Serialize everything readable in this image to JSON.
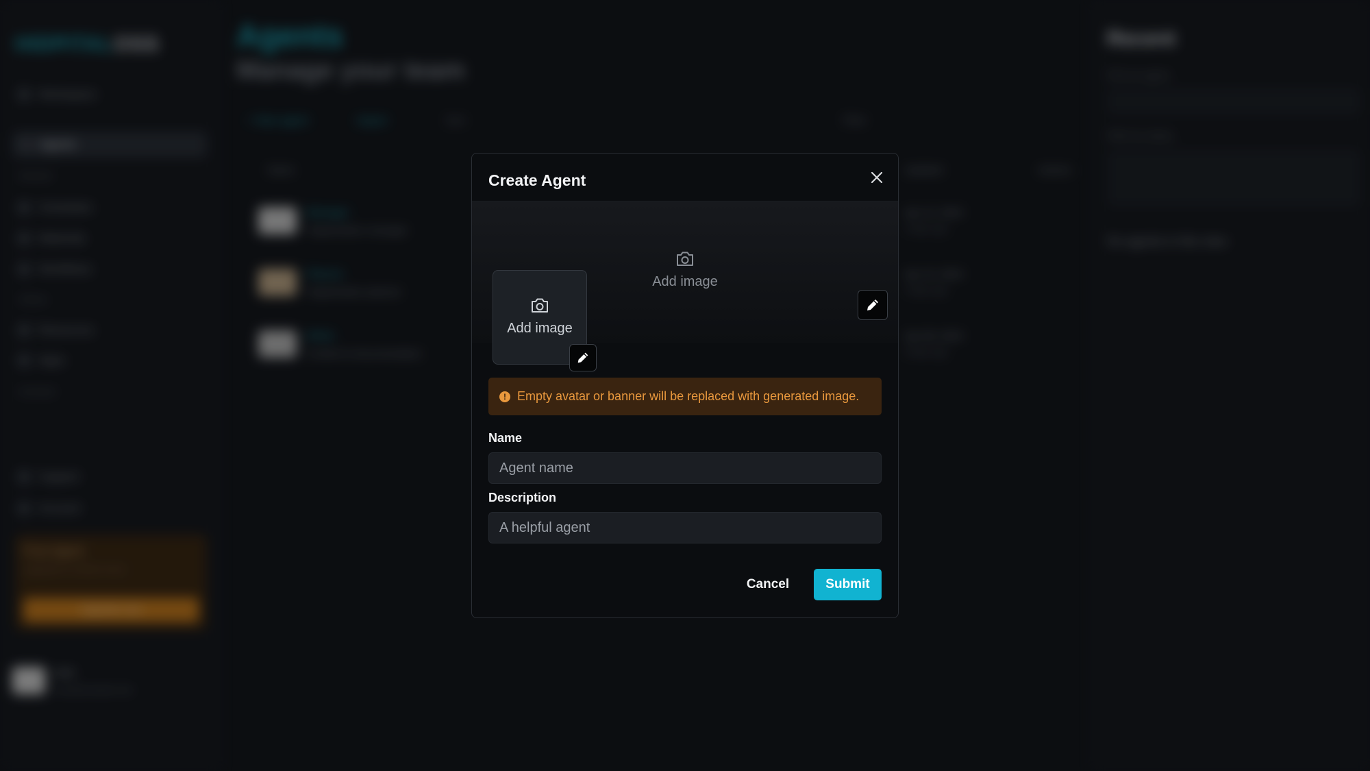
{
  "background": {
    "logo_part1": "HIDPITAL",
    "logo_part2": "OSS",
    "sidebar_items": [
      "Workspace",
      "Agents",
      "Schedules",
      "Materials",
      "Workflows",
      "Resources",
      "Apps",
      "Support",
      "Account"
    ],
    "sidebar_sections": [
      "General",
      "Library",
      "Archived"
    ],
    "promo": {
      "title": "Free Agent",
      "subtitle": "Upgrade to unlock more",
      "button": "Upgrade now"
    },
    "user": {
      "name": "User",
      "email": "user@example.com"
    },
    "page_title": "Agents",
    "page_subtitle": "Manage your team",
    "toolbar": [
      "+ New agent",
      "Import",
      "Sort",
      "Filter"
    ],
    "table_headers": [
      "Name",
      "Updated",
      "Actions"
    ],
    "rows": [
      {
        "name": "Manager",
        "desc": "Organization manager",
        "date": "Apr 12, 2024",
        "date2": "2 days ago"
      },
      {
        "name": "Planner",
        "desc": "Organization planner",
        "date": "Apr 10, 2024",
        "date2": "4 days ago"
      },
      {
        "name": "Writer",
        "desc": "Content & documentation",
        "date": "Apr 08, 2024",
        "date2": "6 days ago"
      }
    ],
    "right_panel": {
      "title": "Recent",
      "label1": "Pick an agent",
      "label2": "Filter by status",
      "empty": "No agents in this view"
    }
  },
  "modal": {
    "title": "Create Agent",
    "banner_add_label": "Add image",
    "avatar_add_label": "Add image",
    "warning": "Empty avatar or banner will be replaced with generated image.",
    "name_label": "Name",
    "name_placeholder": "Agent name",
    "description_label": "Description",
    "description_placeholder": "A helpful agent",
    "cancel_label": "Cancel",
    "submit_label": "Submit"
  },
  "colors": {
    "accent": "#11b3d1",
    "warning_text": "#e9983d",
    "warning_bg": "#3a2410",
    "modal_bg": "#0b0d10"
  },
  "icons": [
    "close-icon",
    "camera-icon",
    "pencil-icon",
    "info-icon"
  ]
}
